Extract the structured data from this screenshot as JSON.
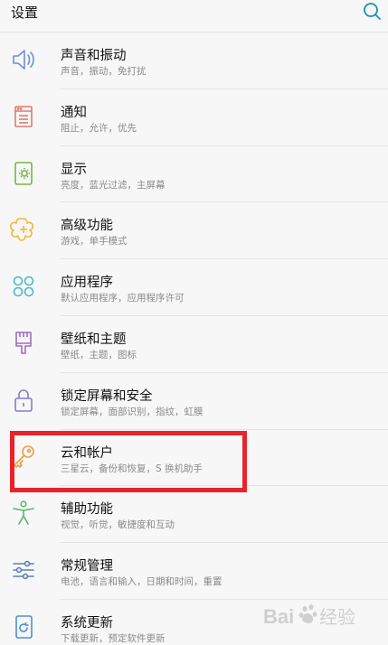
{
  "header": {
    "title": "设置",
    "search_icon": "search-icon"
  },
  "items": [
    {
      "key": "sound",
      "title": "声音和振动",
      "subtitle": "声音，振动，免打扰",
      "icon": "speaker-icon",
      "icon_color": "#6b8fd6"
    },
    {
      "key": "notifications",
      "title": "通知",
      "subtitle": "阻止，允许，优先",
      "icon": "notification-icon",
      "icon_color": "#e07a6f"
    },
    {
      "key": "display",
      "title": "显示",
      "subtitle": "亮度，蓝光过滤，主屏幕",
      "icon": "display-icon",
      "icon_color": "#7cb342"
    },
    {
      "key": "advanced",
      "title": "高级功能",
      "subtitle": "游戏，单手模式",
      "icon": "advanced-features-icon",
      "icon_color": "#f0b93c"
    },
    {
      "key": "apps",
      "title": "应用程序",
      "subtitle": "默认应用程序，应用程序许可",
      "icon": "apps-icon",
      "icon_color": "#4fb7c9"
    },
    {
      "key": "wallpaper",
      "title": "壁纸和主题",
      "subtitle": "壁纸，主题，图标",
      "icon": "paintbrush-icon",
      "icon_color": "#a06cc0"
    },
    {
      "key": "lock",
      "title": "锁定屏幕和安全",
      "subtitle": "锁定屏幕，面部识别，指纹，虹膜",
      "icon": "lock-icon",
      "icon_color": "#8a7bc6"
    },
    {
      "key": "cloud",
      "title": "云和帐户",
      "subtitle": "三星云，备份和恢复，S 换机助手",
      "icon": "key-icon",
      "icon_color": "#e8a04a"
    },
    {
      "key": "accessibility",
      "title": "辅助功能",
      "subtitle": "视觉，听觉，敏捷度和互动",
      "icon": "accessibility-icon",
      "icon_color": "#5bb86a"
    },
    {
      "key": "general",
      "title": "常规管理",
      "subtitle": "电池，语言和输入，日期和时间，重置",
      "icon": "sliders-icon",
      "icon_color": "#5a7fb4"
    },
    {
      "key": "update",
      "title": "系统更新",
      "subtitle": "下载更新，预定软件更新",
      "icon": "system-update-icon",
      "icon_color": "#4a90d9"
    }
  ],
  "highlight": {
    "target": "cloud",
    "color": "#e8232a"
  },
  "watermark": {
    "text": "Baidu 经验"
  }
}
